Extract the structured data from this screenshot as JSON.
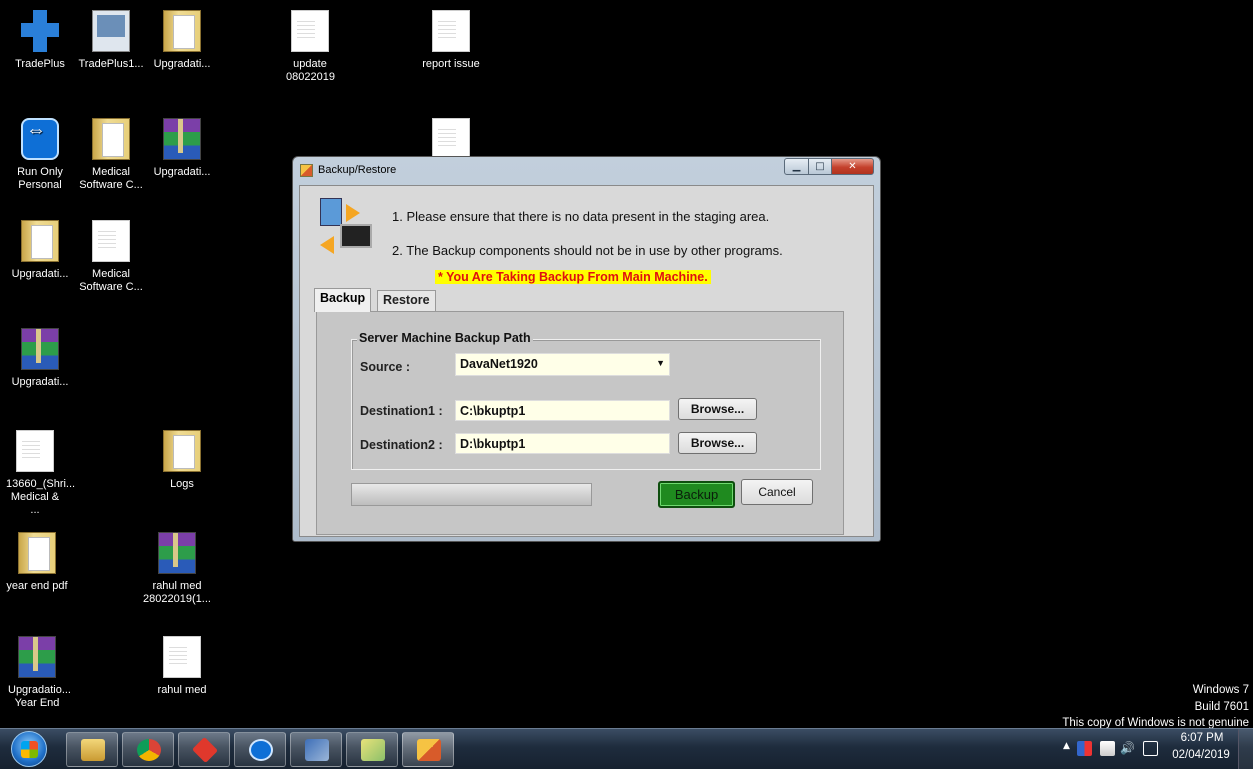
{
  "desktop": {
    "icons": [
      {
        "label": "TradePlus",
        "icon": "tradeplus-icon"
      },
      {
        "label": "TradePlus1...",
        "icon": "shortcut-icon"
      },
      {
        "label": "Upgradati...",
        "icon": "folder-icon"
      },
      {
        "label": "update 08022019",
        "icon": "document-icon"
      },
      {
        "label": "report issue",
        "icon": "document-icon"
      },
      {
        "label": "Run Only Personal",
        "icon": "teamviewer-icon"
      },
      {
        "label": "Medical Software C...",
        "icon": "folder-icon"
      },
      {
        "label": "Upgradati...",
        "icon": "winrar-archive-icon"
      },
      {
        "label": "Upgradati...",
        "icon": "folder-icon"
      },
      {
        "label": "Medical Software C...",
        "icon": "document-icon"
      },
      {
        "label": "Upgradati...",
        "icon": "winrar-archive-icon"
      },
      {
        "label": "13660_(Shri... Medical & ...",
        "icon": "document-icon"
      },
      {
        "label": "Logs",
        "icon": "folder-icon"
      },
      {
        "label": "year end pdf",
        "icon": "folder-icon"
      },
      {
        "label": "rahul med 28022019(1...",
        "icon": "winrar-archive-icon"
      },
      {
        "label": "Upgradatio... Year End",
        "icon": "winrar-archive-icon"
      },
      {
        "label": "rahul med",
        "icon": "document-icon"
      }
    ]
  },
  "dialog": {
    "title": "Backup/Restore",
    "instruction1": "1. Please ensure that there is no data present in the staging area.",
    "instruction2": "2. The Backup components should not be in use by other programs.",
    "warning": "* You Are Taking Backup From Main Machine.",
    "tabs": [
      {
        "label": "Backup",
        "active": true
      },
      {
        "label": "Restore",
        "active": false
      }
    ],
    "group_title": "Server Machine Backup Path",
    "source_label": "Source  :",
    "source_value": "DavaNet1920",
    "dest1_label": "Destination1  :",
    "dest1_value": "C:\\bkuptp1",
    "dest2_label": "Destination2  :",
    "dest2_value": "D:\\bkuptp1",
    "browse_label": "Browse...",
    "progress": 0,
    "backup_button": "Backup",
    "cancel_button": "Cancel"
  },
  "watermark": {
    "line1": "Windows 7",
    "line2": "Build 7601",
    "line3": "This copy of Windows is not genuine"
  },
  "taskbar": {
    "apps": [
      "file-explorer-icon",
      "chrome-icon",
      "anydesk-icon",
      "teamviewer-icon",
      "network-setup-icon",
      "sticky-notes-icon",
      "backup-restore-app-icon"
    ],
    "clock_time": "6:07 PM",
    "clock_date": "02/04/2019"
  },
  "colors": {
    "desktop": "#000000",
    "backup_button": "#1f8a1f",
    "warning_bg": "#ffff00",
    "warning_text": "#e01010"
  }
}
